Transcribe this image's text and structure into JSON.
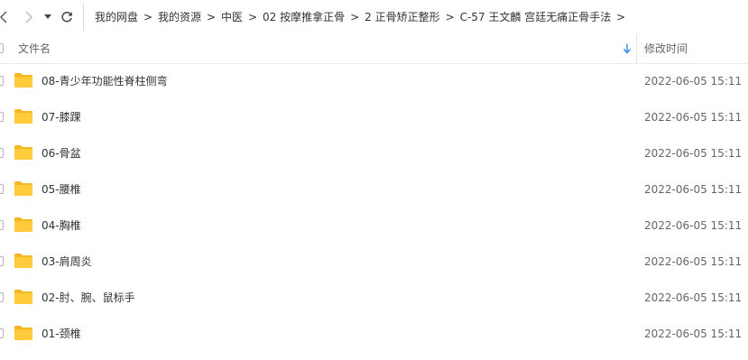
{
  "nav": {
    "back_icon": "chevron-left-icon",
    "forward_icon": "chevron-right-icon",
    "history_icon": "caret-down-icon",
    "refresh_icon": "refresh-icon",
    "separator": ">"
  },
  "breadcrumbs": [
    "我的网盘",
    "我的资源",
    "中医",
    "02 按摩推拿正骨",
    "2 正骨矫正整形",
    "C-57 王文麟 宫廷无痛正骨手法"
  ],
  "columns": {
    "name": "文件名",
    "modified": "修改时间",
    "sort_icon": "sort-down-icon"
  },
  "files": [
    {
      "name": "08-青少年功能性脊柱侧弯",
      "modified": "2022-06-05 15:11",
      "icon": "folder-icon"
    },
    {
      "name": "07-膝踝",
      "modified": "2022-06-05 15:11",
      "icon": "folder-icon"
    },
    {
      "name": "06-骨盆",
      "modified": "2022-06-05 15:11",
      "icon": "folder-icon"
    },
    {
      "name": "05-腰椎",
      "modified": "2022-06-05 15:11",
      "icon": "folder-icon"
    },
    {
      "name": "04-胸椎",
      "modified": "2022-06-05 15:11",
      "icon": "folder-icon"
    },
    {
      "name": "03-肩周炎",
      "modified": "2022-06-05 15:11",
      "icon": "folder-icon"
    },
    {
      "name": "02-肘、腕、鼠标手",
      "modified": "2022-06-05 15:11",
      "icon": "folder-icon"
    },
    {
      "name": "01-颈椎",
      "modified": "2022-06-05 15:11",
      "icon": "folder-icon"
    }
  ],
  "colors": {
    "folder": "#FFCB3D",
    "folder_tab": "#F5B821",
    "sort_arrow": "#2D8CF0"
  }
}
